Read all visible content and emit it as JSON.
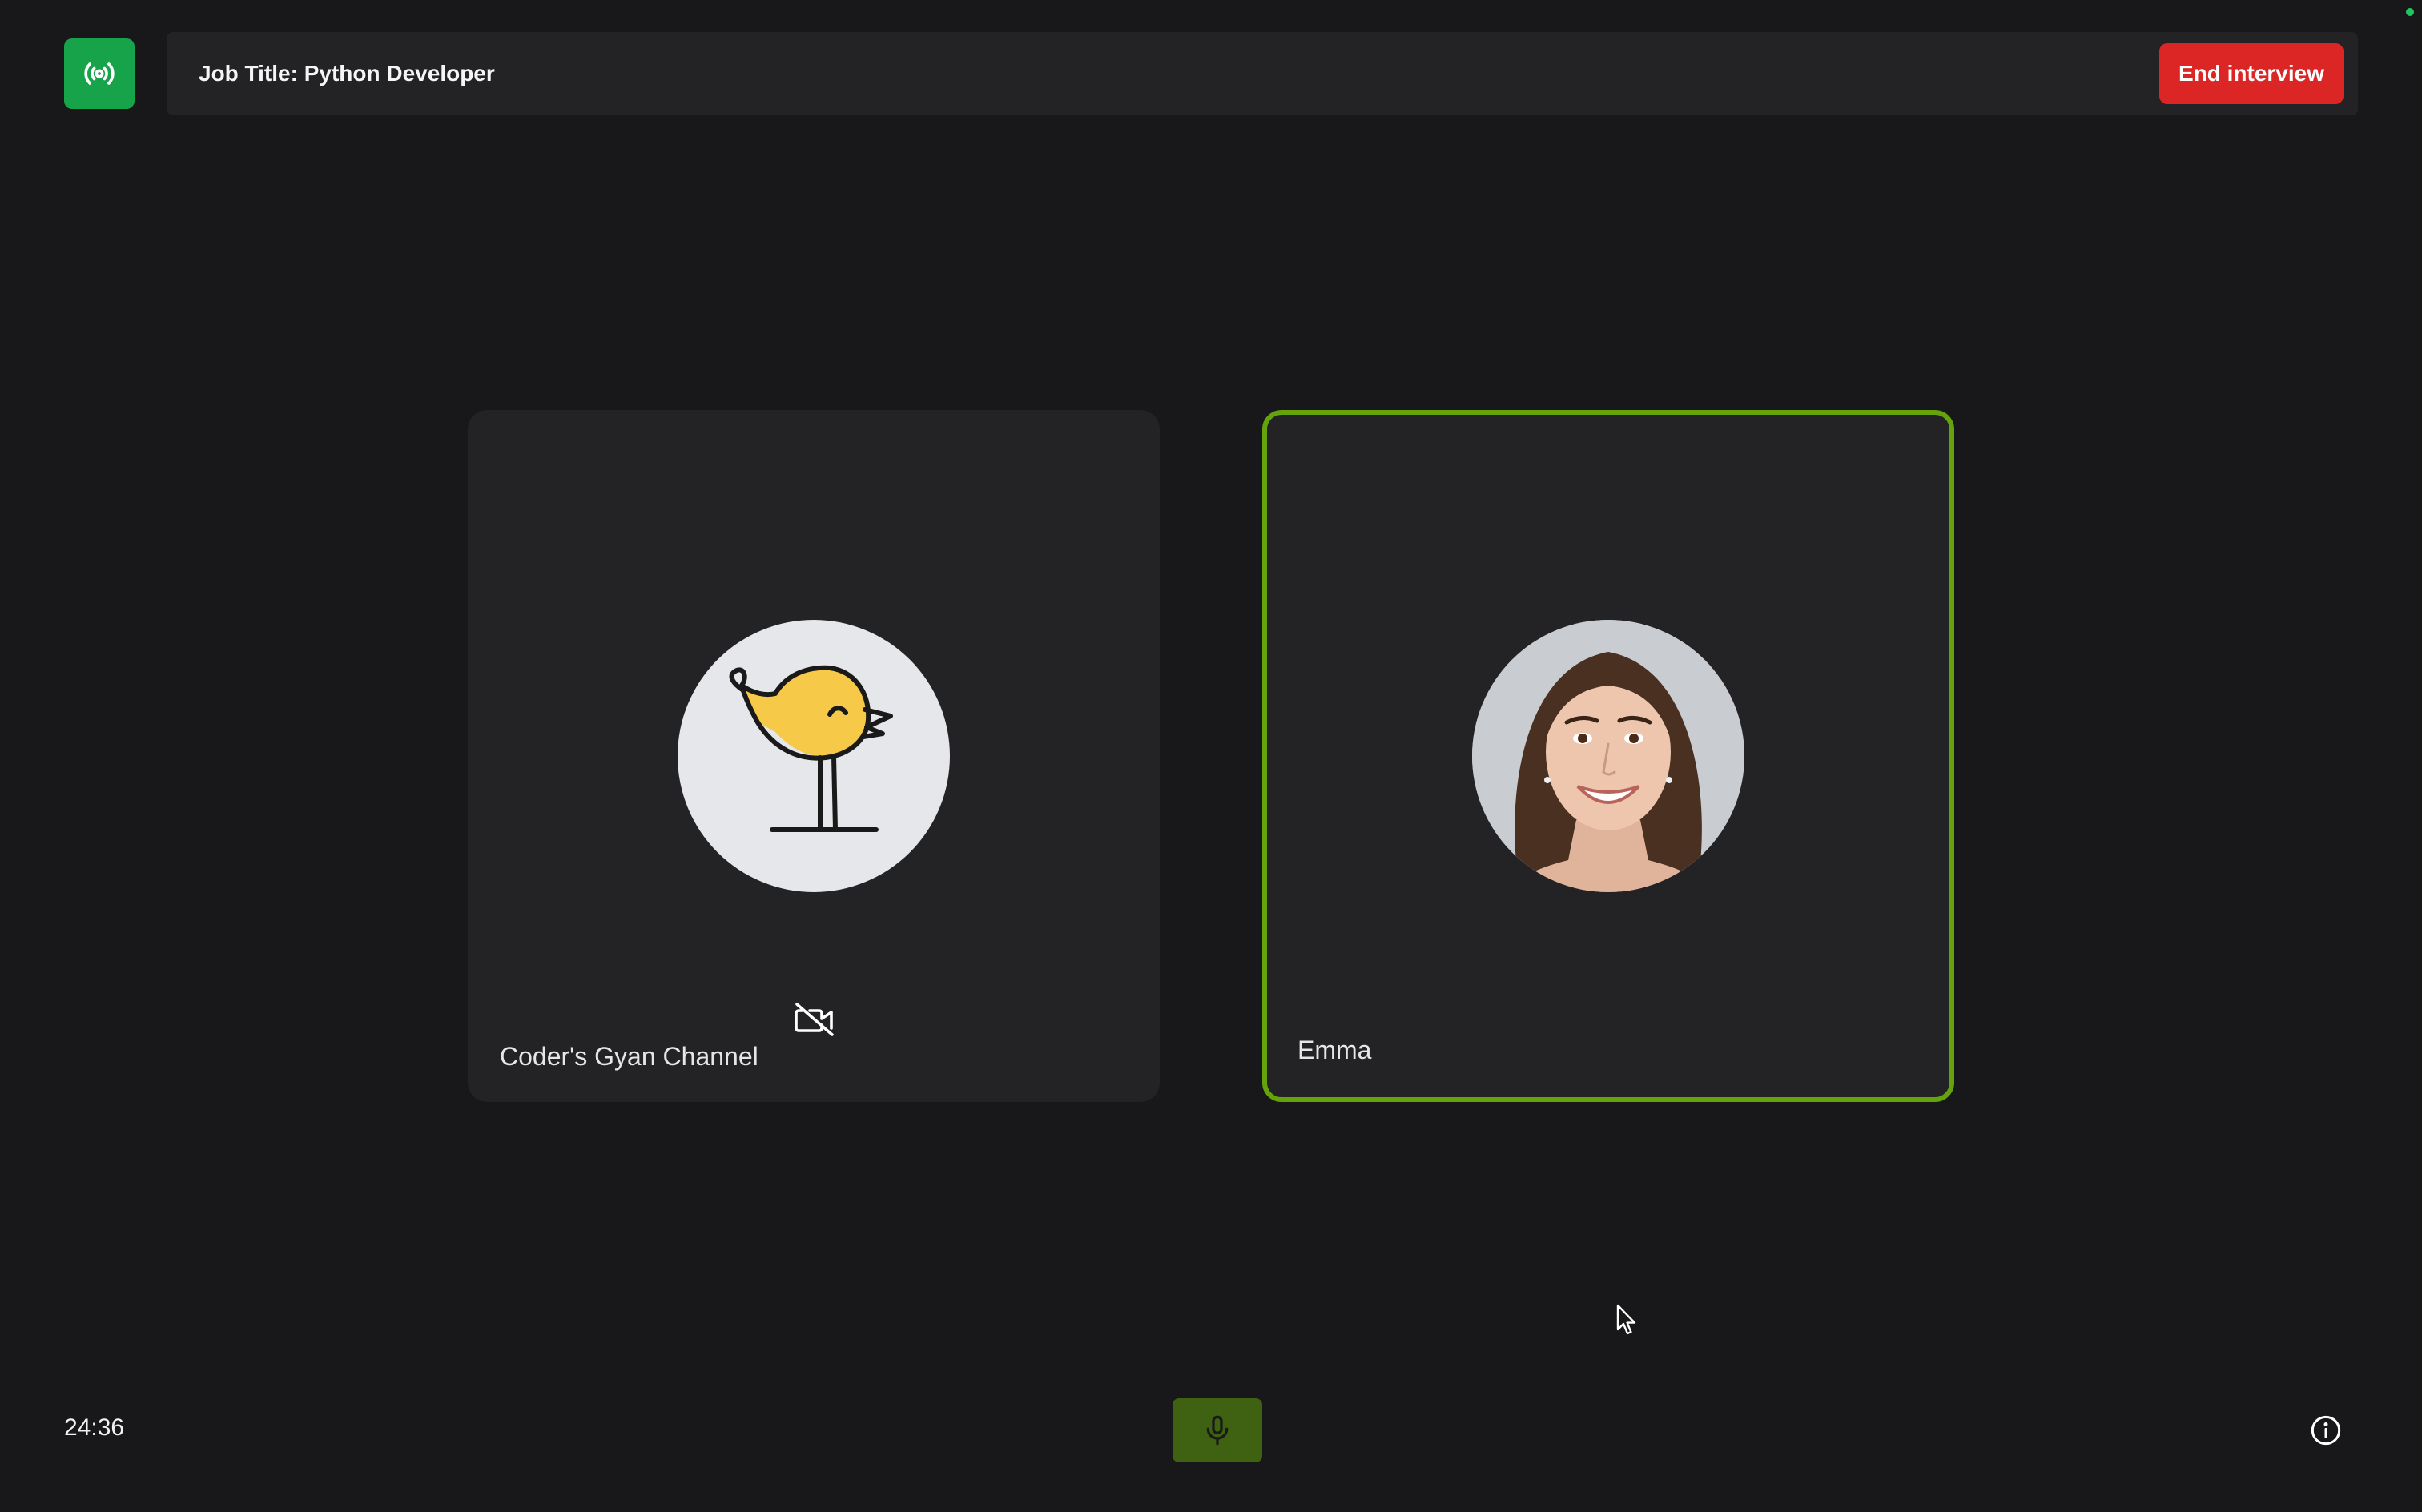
{
  "header": {
    "job_title": "Job Title: Python Developer",
    "end_button_label": "End interview",
    "logo_icon": "broadcast-signal-icon"
  },
  "participants": [
    {
      "name": "Coder's Gyan Channel",
      "avatar": "bird-logo-icon",
      "camera_off": true,
      "camera_icon": "camera-off-icon"
    },
    {
      "name": "Emma",
      "avatar": "profile-photo",
      "active_speaker": true
    }
  ],
  "footer": {
    "timer": "24:36",
    "mic_icon": "microphone-icon",
    "info_icon": "info-icon"
  },
  "colors": {
    "background": "#18181a",
    "panel": "#232325",
    "logo_green": "#16a34a",
    "end_button_red": "#dc2626",
    "active_border": "#65a30d",
    "mic_button": "#3f6212"
  }
}
